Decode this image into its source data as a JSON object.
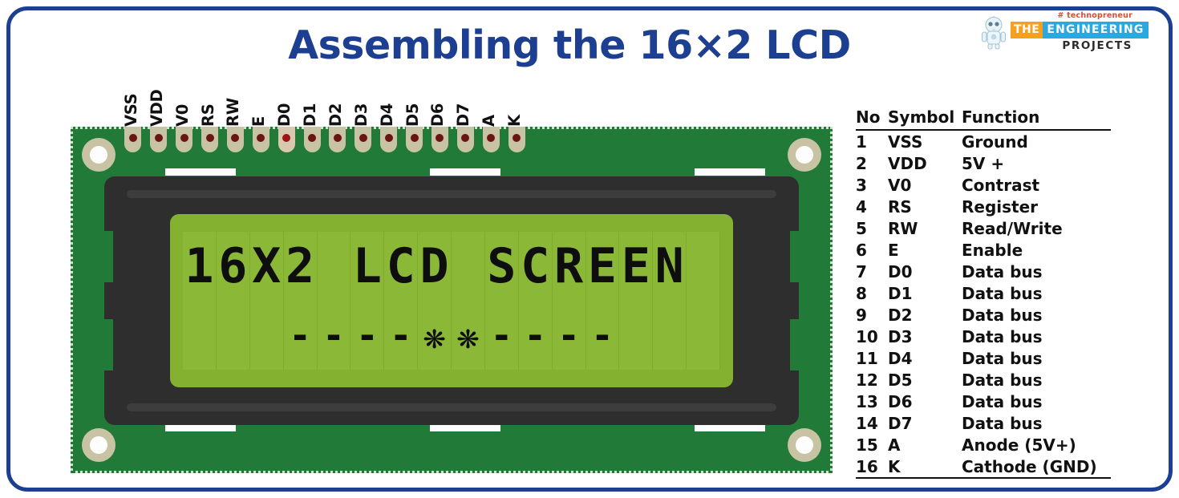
{
  "page": {
    "title": "Assembling the 16×2 LCD",
    "border_color": "#1d3f91",
    "title_color": "#1d3f91",
    "background": "#ffffff"
  },
  "logo": {
    "tagline": "# technopreneur",
    "word_the": "THE",
    "word_engineering": "ENGINEERING",
    "word_projects": "PROJECTS",
    "color_the_bg": "#f5a11e",
    "color_engineering_bg": "#2aa8e0",
    "color_tagline": "#e8472b",
    "color_projects": "#2b2b2b"
  },
  "pcb": {
    "board_color": "#227a38",
    "bezel_color": "#2e2e2e",
    "lcd_color": "#85b131",
    "pad_color": "#c8c3a4",
    "pin_labels": [
      "VSS",
      "VDD",
      "V0",
      "RS",
      "RW",
      "E",
      "D0",
      "D1",
      "D2",
      "D3",
      "D4",
      "D5",
      "D6",
      "D7",
      "A",
      "K"
    ],
    "active_pin_index": 6
  },
  "lcd_display": {
    "line1": [
      "1",
      "6",
      "X",
      "2",
      " ",
      "L",
      "C",
      "D",
      " ",
      "S",
      "C",
      "R",
      "E",
      "E",
      "N",
      " "
    ],
    "line2": [
      " ",
      " ",
      " ",
      "-",
      "-",
      "-",
      "-",
      "❋",
      "❋",
      "-",
      "-",
      "-",
      "-",
      " ",
      " ",
      " "
    ],
    "line1_text": "16X2 LCD SCREEN",
    "line2_text": "----❋❋----",
    "columns": 16,
    "rows": 2
  },
  "pin_table": {
    "headers": [
      "No",
      "Symbol",
      "Function"
    ],
    "rows": [
      {
        "no": "1",
        "symbol": "VSS",
        "function": "Ground"
      },
      {
        "no": "2",
        "symbol": "VDD",
        "function": "5V +"
      },
      {
        "no": "3",
        "symbol": "V0",
        "function": "Contrast"
      },
      {
        "no": "4",
        "symbol": "RS",
        "function": "Register"
      },
      {
        "no": "5",
        "symbol": "RW",
        "function": "Read/Write"
      },
      {
        "no": "6",
        "symbol": "E",
        "function": "Enable"
      },
      {
        "no": "7",
        "symbol": "D0",
        "function": "Data bus"
      },
      {
        "no": "8",
        "symbol": "D1",
        "function": "Data bus"
      },
      {
        "no": "9",
        "symbol": "D2",
        "function": "Data bus"
      },
      {
        "no": "10",
        "symbol": "D3",
        "function": "Data bus"
      },
      {
        "no": "11",
        "symbol": "D4",
        "function": "Data bus"
      },
      {
        "no": "12",
        "symbol": "D5",
        "function": "Data bus"
      },
      {
        "no": "13",
        "symbol": "D6",
        "function": "Data bus"
      },
      {
        "no": "14",
        "symbol": "D7",
        "function": "Data bus"
      },
      {
        "no": "15",
        "symbol": "A",
        "function": "Anode (5V+)"
      },
      {
        "no": "16",
        "symbol": "K",
        "function": "Cathode (GND)"
      }
    ]
  }
}
